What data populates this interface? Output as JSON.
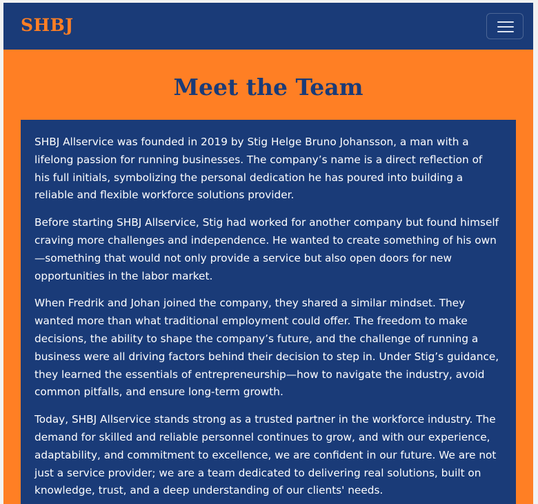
{
  "navbar": {
    "brand": "SHBJ",
    "toggle_icon": "hamburger-menu-icon"
  },
  "page": {
    "title": "Meet the Team"
  },
  "about": {
    "paragraphs": [
      "SHBJ Allservice was founded in 2019 by Stig Helge Bruno Johansson, a man with a lifelong passion for running businesses. The company’s name is a direct reflection of his full initials, symbolizing the personal dedication he has poured into building a reliable and flexible workforce solutions provider.",
      "Before starting SHBJ Allservice, Stig had worked for another company but found himself craving more challenges and independence. He wanted to create something of his own—something that would not only provide a service but also open doors for new opportunities in the labor market.",
      "When Fredrik and Johan joined the company, they shared a similar mindset. They wanted more than what traditional employment could offer. The freedom to make decisions, the ability to shape the company’s future, and the challenge of running a business were all driving factors behind their decision to step in. Under Stig’s guidance, they learned the essentials of entrepreneurship—how to navigate the industry, avoid common pitfalls, and ensure long-term growth.",
      "Today, SHBJ Allservice stands strong as a trusted partner in the workforce industry. The demand for skilled and reliable personnel continues to grow, and with our experience, adaptability, and commitment to excellence, we are confident in our future. We are not just a service provider; we are a team dedicated to delivering real solutions, built on knowledge, trust, and a deep understanding of our clients' needs."
    ]
  },
  "colors": {
    "navy": "#1a3b78",
    "orange": "#ff7f24",
    "text": "#ffffff"
  }
}
